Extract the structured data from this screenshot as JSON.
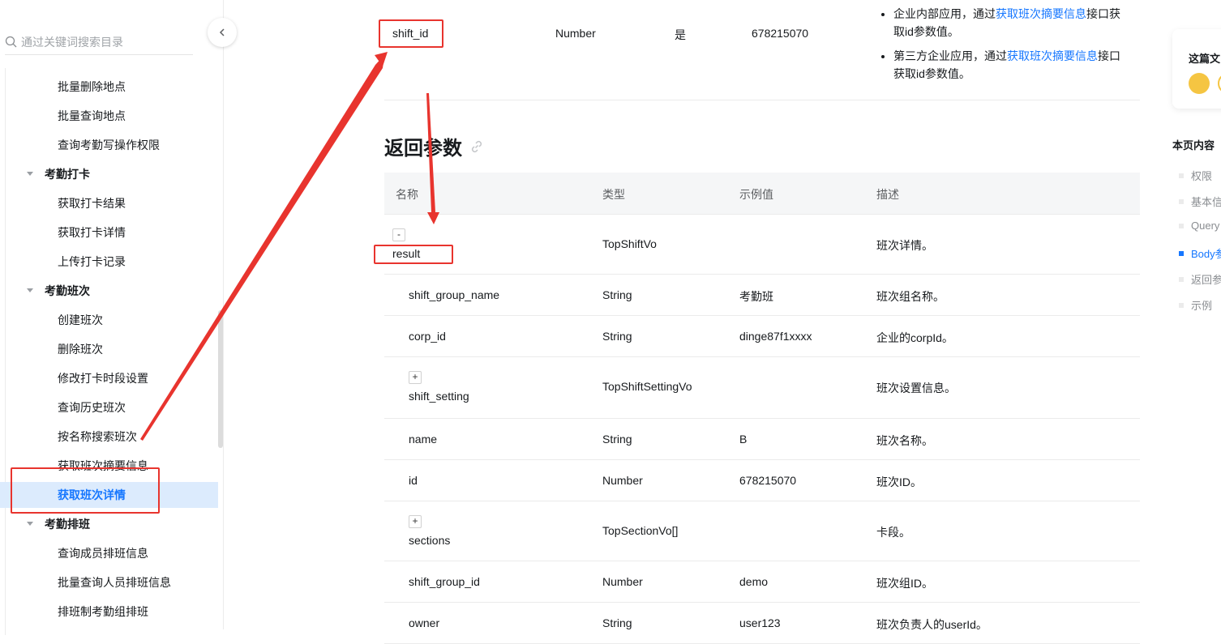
{
  "sidebar": {
    "search_placeholder": "通过关键词搜索目录",
    "items": [
      {
        "label": "批量删除地点",
        "type": "leaf"
      },
      {
        "label": "批量查询地点",
        "type": "leaf"
      },
      {
        "label": "查询考勤写操作权限",
        "type": "leaf"
      },
      {
        "label": "考勤打卡",
        "type": "group"
      },
      {
        "label": "获取打卡结果",
        "type": "leaf"
      },
      {
        "label": "获取打卡详情",
        "type": "leaf"
      },
      {
        "label": "上传打卡记录",
        "type": "leaf"
      },
      {
        "label": "考勤班次",
        "type": "group"
      },
      {
        "label": "创建班次",
        "type": "leaf"
      },
      {
        "label": "删除班次",
        "type": "leaf"
      },
      {
        "label": "修改打卡时段设置",
        "type": "leaf"
      },
      {
        "label": "查询历史班次",
        "type": "leaf"
      },
      {
        "label": "按名称搜索班次",
        "type": "leaf"
      },
      {
        "label": "获取班次摘要信息",
        "type": "leaf"
      },
      {
        "label": "获取班次详情",
        "type": "active"
      },
      {
        "label": "考勤排班",
        "type": "group"
      },
      {
        "label": "查询成员排班信息",
        "type": "leaf"
      },
      {
        "label": "批量查询人员排班信息",
        "type": "leaf"
      },
      {
        "label": "排班制考勤组排班",
        "type": "leaf"
      }
    ]
  },
  "request_row": {
    "name": "shift_id",
    "type": "Number",
    "required": "是",
    "example": "678215070",
    "desc1_pre": "企业内部应用，通过",
    "desc1_link": "获取班次摘要信息",
    "desc1_post": "接口获取id参数值。",
    "desc2_pre": "第三方企业应用，通过",
    "desc2_link": "获取班次摘要信息",
    "desc2_post": "接口获取id参数值。"
  },
  "return_section": {
    "title": "返回参数",
    "headers": {
      "name": "名称",
      "type": "类型",
      "example": "示例值",
      "desc": "描述"
    },
    "rows": [
      {
        "toggle": "-",
        "name": "result",
        "type": "TopShiftVo",
        "example": "",
        "desc": "班次详情。"
      },
      {
        "toggle": "",
        "name": "shift_group_name",
        "type": "String",
        "example": "考勤班",
        "desc": "班次组名称。"
      },
      {
        "toggle": "",
        "name": "corp_id",
        "type": "String",
        "example": "dinge87f1xxxx",
        "desc": "企业的corpId。"
      },
      {
        "toggle": "+",
        "name": "shift_setting",
        "type": "TopShiftSettingVo",
        "example": "",
        "desc": "班次设置信息。"
      },
      {
        "toggle": "",
        "name": "name",
        "type": "String",
        "example": "B",
        "desc": "班次名称。"
      },
      {
        "toggle": "",
        "name": "id",
        "type": "Number",
        "example": "678215070",
        "desc": "班次ID。"
      },
      {
        "toggle": "+",
        "name": "sections",
        "type": "TopSectionVo[]",
        "example": "",
        "desc": "卡段。"
      },
      {
        "toggle": "",
        "name": "shift_group_id",
        "type": "Number",
        "example": "demo",
        "desc": "班次组ID。"
      },
      {
        "toggle": "",
        "name": "owner",
        "type": "String",
        "example": "user123",
        "desc": "班次负责人的userId。"
      }
    ]
  },
  "right_panel": {
    "feedback_title": "这篇文",
    "toc_title": "本页内容",
    "toc_items": [
      {
        "label": "权限",
        "active": false
      },
      {
        "label": "基本信",
        "active": false
      },
      {
        "label": "Query",
        "active": false
      },
      {
        "label": "Body参",
        "active": true
      },
      {
        "label": "返回参",
        "active": false
      },
      {
        "label": "示例",
        "active": false
      }
    ]
  },
  "colors": {
    "accent": "#1677ff",
    "annotation": "#e8342e",
    "active_bg": "#dcebfd"
  },
  "icons": {
    "search": "search-icon",
    "collapse": "chevron-left-icon",
    "anchor": "link-icon"
  }
}
